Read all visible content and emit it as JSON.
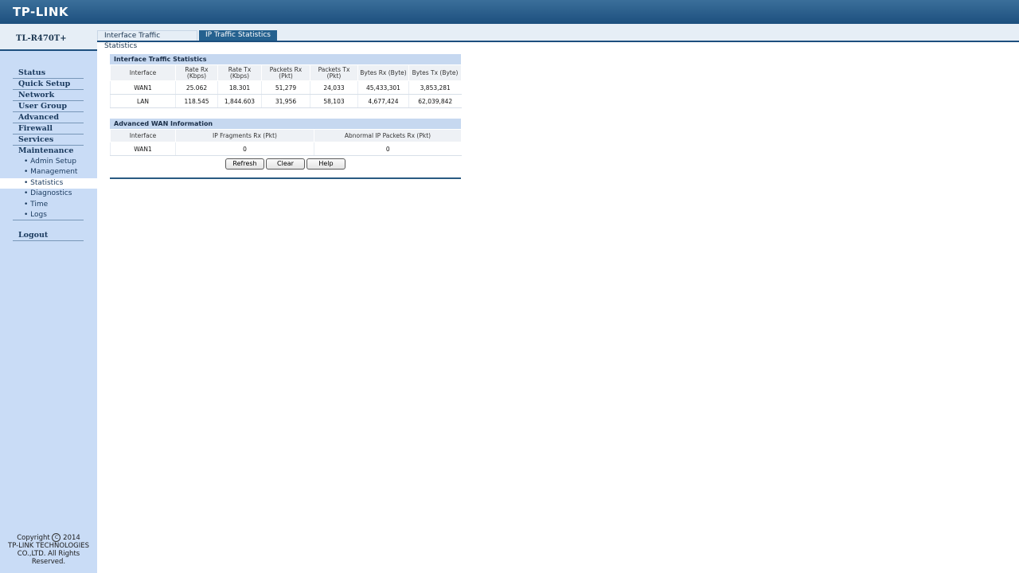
{
  "header": {
    "logo": "TP-LINK"
  },
  "tabs": [
    {
      "label": "Interface Traffic Statistics"
    },
    {
      "label": "IP Traffic Statistics"
    }
  ],
  "sidebar": {
    "model": "TL-R470T+",
    "menu": [
      "Status",
      "Quick Setup",
      "Network",
      "User Group",
      "Advanced",
      "Firewall",
      "Services",
      "Maintenance"
    ],
    "submenu": [
      "Admin Setup",
      "Management",
      "Statistics",
      "Diagnostics",
      "Time",
      "Logs"
    ],
    "logout": "Logout",
    "copyright": {
      "line1": "Copyright",
      "year": "2014",
      "line2": "TP-LINK TECHNOLOGIES",
      "line3": "CO.,LTD. All Rights",
      "line4": "Reserved."
    }
  },
  "interface_stats": {
    "title": "Interface Traffic Statistics",
    "headers": [
      {
        "l1": "Interface",
        "l2": ""
      },
      {
        "l1": "Rate Rx",
        "l2": "(Kbps)"
      },
      {
        "l1": "Rate Tx",
        "l2": "(Kbps)"
      },
      {
        "l1": "Packets Rx",
        "l2": "(Pkt)"
      },
      {
        "l1": "Packets Tx",
        "l2": "(Pkt)"
      },
      {
        "l1": "Bytes Rx (Byte)",
        "l2": ""
      },
      {
        "l1": "Bytes Tx (Byte)",
        "l2": ""
      }
    ],
    "rows": [
      [
        "WAN1",
        "25.062",
        "18.301",
        "51,279",
        "24,033",
        "45,433,301",
        "3,853,281"
      ],
      [
        "LAN",
        "118.545",
        "1,844.603",
        "31,956",
        "58,103",
        "4,677,424",
        "62,039,842"
      ]
    ]
  },
  "wan_info": {
    "title": "Advanced WAN Information",
    "headers": [
      "Interface",
      "IP Fragments Rx (Pkt)",
      "Abnormal IP Packets Rx (Pkt)"
    ],
    "rows": [
      [
        "WAN1",
        "0",
        "0"
      ]
    ]
  },
  "buttons": {
    "refresh": "Refresh",
    "clear": "Clear",
    "help": "Help"
  }
}
